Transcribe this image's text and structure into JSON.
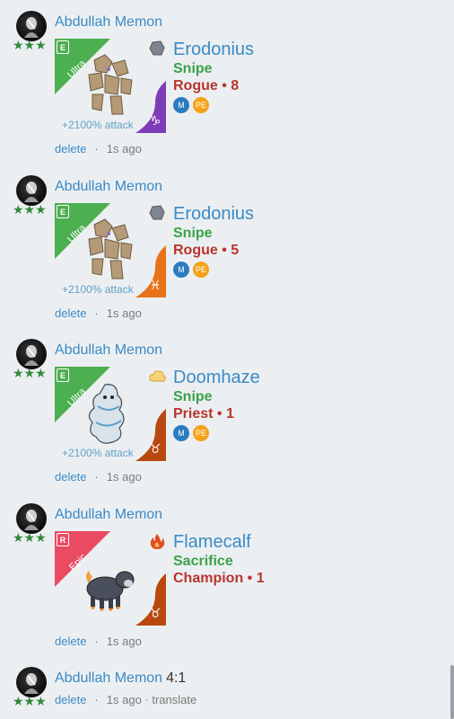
{
  "colors": {
    "background": "#eceff1",
    "link": "#3a8ac7",
    "ability": "#3aa24a",
    "class": "#b9342d",
    "stars": "#2e8b3b",
    "ultra_ribbon": "#4caf50",
    "epic_ribbon": "#e94b63",
    "rogue_sign": "#7e3db8",
    "orange_sign": "#e8731a",
    "brown_sign": "#b8480f"
  },
  "posts": [
    {
      "user": "Abdullah Memon",
      "stars": "★★★",
      "card": {
        "rarity_letter": "E",
        "rarity_label": "Ultra",
        "attack": "+2100% attack",
        "sign_icon": "capricorn-icon",
        "sign_glyph": "♑",
        "creature_icon": "rock-golem-icon"
      },
      "element_icon": "stone-element-icon",
      "name": "Erodonius",
      "ability": "Snipe",
      "class_line": "Rogue • 8",
      "badges": [
        "M",
        "PE"
      ],
      "delete": "delete",
      "separator": "·",
      "time": "1s ago"
    },
    {
      "user": "Abdullah Memon",
      "stars": "★★★",
      "card": {
        "rarity_letter": "E",
        "rarity_label": "Ultra",
        "attack": "+2100% attack",
        "sign_icon": "pisces-icon",
        "sign_glyph": "♓",
        "creature_icon": "rock-golem-icon"
      },
      "element_icon": "stone-element-icon",
      "name": "Erodonius",
      "ability": "Snipe",
      "class_line": "Rogue • 5",
      "badges": [
        "M",
        "PE"
      ],
      "delete": "delete",
      "separator": "·",
      "time": "1s ago"
    },
    {
      "user": "Abdullah Memon",
      "stars": "★★★",
      "card": {
        "rarity_letter": "E",
        "rarity_label": "Ultra",
        "attack": "+2100% attack",
        "sign_icon": "taurus-icon",
        "sign_glyph": "♉",
        "creature_icon": "storm-spirit-icon"
      },
      "element_icon": "cloud-element-icon",
      "name": "Doomhaze",
      "ability": "Snipe",
      "class_line": "Priest • 1",
      "badges": [
        "M",
        "PE"
      ],
      "delete": "delete",
      "separator": "·",
      "time": "1s ago"
    },
    {
      "user": "Abdullah Memon",
      "stars": "★★★",
      "card": {
        "rarity_letter": "R",
        "rarity_label": "Epic",
        "attack": "",
        "sign_icon": "taurus-icon",
        "sign_glyph": "♉",
        "creature_icon": "fire-calf-icon"
      },
      "element_icon": "fire-element-icon",
      "name": "Flamecalf",
      "ability": "Sacrifice",
      "class_line": "Champion • 1",
      "badges": [],
      "delete": "delete",
      "separator": "·",
      "time": "1s ago"
    }
  ],
  "last_message": {
    "user": "Abdullah Memon",
    "text": "4:1",
    "stars": "★★★",
    "delete": "delete",
    "separator": "·",
    "time_translate": "1s ago · translate"
  }
}
